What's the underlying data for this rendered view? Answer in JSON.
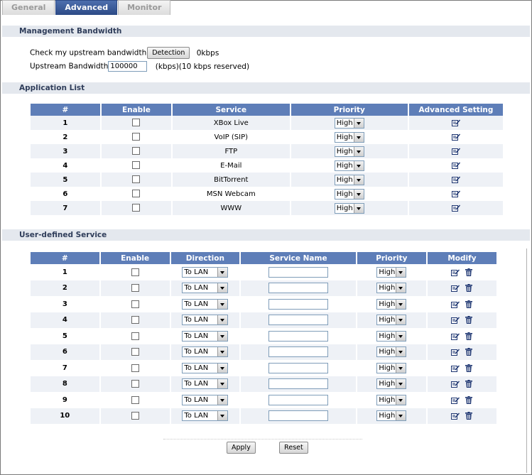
{
  "tabs": [
    {
      "label": "General"
    },
    {
      "label": "Advanced"
    },
    {
      "label": "Monitor"
    }
  ],
  "management": {
    "title": "Management Bandwidth",
    "check_label": "Check my upstream bandwidth",
    "detection_button": "Detection",
    "detected_value": "0kbps",
    "upstream_label": "Upstream Bandwidth",
    "upstream_value": "100000",
    "upstream_suffix": "(kbps)(10 kbps reserved)"
  },
  "app_list": {
    "title": "Application List",
    "headers": [
      "#",
      "Enable",
      "Service",
      "Priority",
      "Advanced Setting"
    ],
    "rows": [
      {
        "num": "1",
        "service": "XBox Live",
        "priority": "High"
      },
      {
        "num": "2",
        "service": "VoIP (SIP)",
        "priority": "High"
      },
      {
        "num": "3",
        "service": "FTP",
        "priority": "High"
      },
      {
        "num": "4",
        "service": "E-Mail",
        "priority": "High"
      },
      {
        "num": "5",
        "service": "BitTorrent",
        "priority": "High"
      },
      {
        "num": "6",
        "service": "MSN Webcam",
        "priority": "High"
      },
      {
        "num": "7",
        "service": "WWW",
        "priority": "High"
      }
    ]
  },
  "user_defined": {
    "title": "User-defined Service",
    "headers": [
      "#",
      "Enable",
      "Direction",
      "Service Name",
      "Priority",
      "Modify"
    ],
    "rows": [
      {
        "num": "1",
        "direction": "To LAN",
        "service_name": "",
        "priority": "High"
      },
      {
        "num": "2",
        "direction": "To LAN",
        "service_name": "",
        "priority": "High"
      },
      {
        "num": "3",
        "direction": "To LAN",
        "service_name": "",
        "priority": "High"
      },
      {
        "num": "4",
        "direction": "To LAN",
        "service_name": "",
        "priority": "High"
      },
      {
        "num": "5",
        "direction": "To LAN",
        "service_name": "",
        "priority": "High"
      },
      {
        "num": "6",
        "direction": "To LAN",
        "service_name": "",
        "priority": "High"
      },
      {
        "num": "7",
        "direction": "To LAN",
        "service_name": "",
        "priority": "High"
      },
      {
        "num": "8",
        "direction": "To LAN",
        "service_name": "",
        "priority": "High"
      },
      {
        "num": "9",
        "direction": "To LAN",
        "service_name": "",
        "priority": "High"
      },
      {
        "num": "10",
        "direction": "To LAN",
        "service_name": "",
        "priority": "High"
      }
    ]
  },
  "actions": {
    "apply": "Apply",
    "reset": "Reset"
  },
  "colors": {
    "header_blue": "#5e7eb8",
    "tab_active": "#2c4a86",
    "section_bg": "#e4e8ee",
    "row_alt": "#eef1f6"
  },
  "icons": {
    "edit": "edit-icon",
    "delete": "trash-icon"
  }
}
